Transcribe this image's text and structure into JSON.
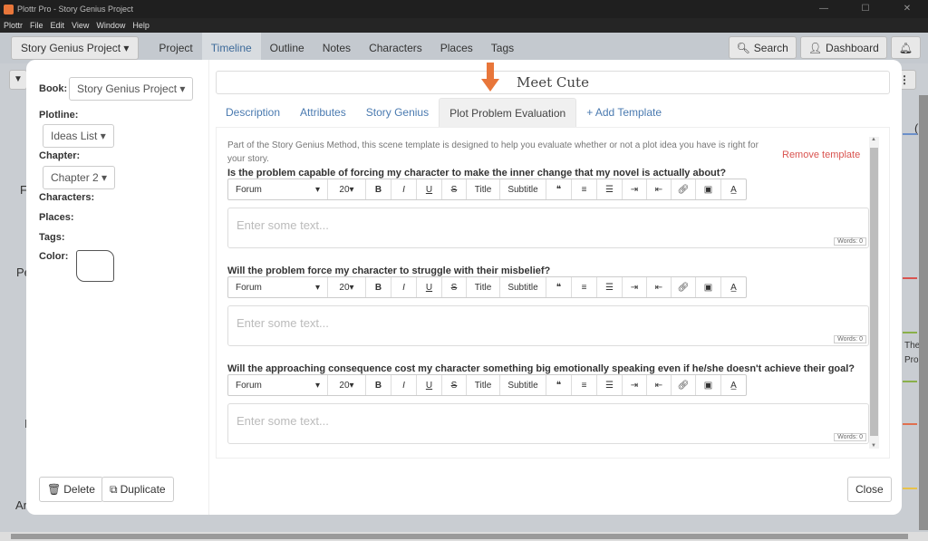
{
  "window": {
    "title": "Plottr Pro - Story Genius Project",
    "controls": [
      "—",
      "☐",
      "✕"
    ]
  },
  "menu": [
    "Plottr",
    "File",
    "Edit",
    "View",
    "Window",
    "Help"
  ],
  "nav": {
    "project": "Story Genius Project ▾",
    "tabs": [
      "Project",
      "Timeline",
      "Outline",
      "Notes",
      "Characters",
      "Places",
      "Tags"
    ],
    "active": "Timeline",
    "search": "Search",
    "dashboard": "Dashboard"
  },
  "background": {
    "labels": [
      "F",
      "Pe",
      "I",
      "Ar",
      "The",
      "Pro",
      "("
    ],
    "line_colors": [
      "#6b8fc9",
      "#d9534f",
      "#8ab04a",
      "#8ab04a",
      "#e0704f",
      "#e8c24a"
    ]
  },
  "card": {
    "book_label": "Book:",
    "book_value": "Story Genius Project ▾",
    "plotline_label": "Plotline:",
    "plotline_value": "Ideas List ▾",
    "chapter_label": "Chapter:",
    "chapter_value": "Chapter 2 ▾",
    "characters_label": "Characters:",
    "places_label": "Places:",
    "tags_label": "Tags:",
    "color_label": "Color:",
    "delete": "Delete",
    "duplicate": "Duplicate",
    "close": "Close",
    "title": "Meet Cute",
    "tabs": [
      "Description",
      "Attributes",
      "Story Genius",
      "Plot Problem Evaluation",
      "+ Add Template"
    ],
    "active_tab": "Plot Problem Evaluation",
    "template_description": "Part of the Story Genius Method, this scene template is designed to help you evaluate whether or not a plot idea you have is right for your story.",
    "remove_template": "Remove template",
    "toolbar": {
      "font": "Forum",
      "size": "20",
      "title": "Title",
      "subtitle": "Subtitle"
    },
    "questions": [
      {
        "q": "Is the problem capable of forcing my character to make the inner change that my novel is actually about?",
        "placeholder": "Enter some text...",
        "words": "Words: 0"
      },
      {
        "q": "Will the problem force my character to struggle with their misbelief?",
        "placeholder": "Enter some text...",
        "words": "Words: 0"
      },
      {
        "q": "Will the approaching consequence cost my character something big emotionally speaking even if he/she doesn't achieve their goal?",
        "placeholder": "Enter some text...",
        "words": "Words: 0"
      }
    ],
    "accent": "#e8763a"
  }
}
